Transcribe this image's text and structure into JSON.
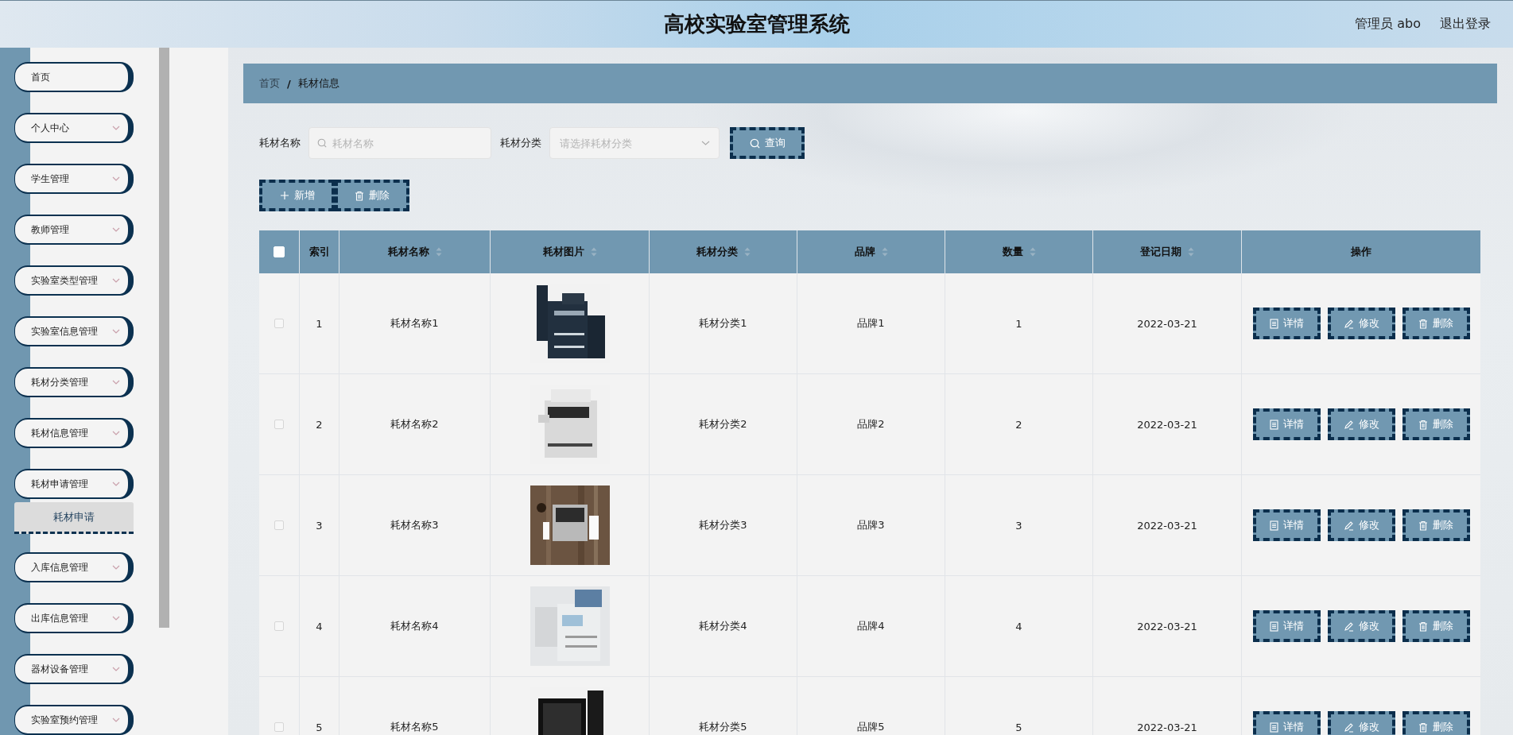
{
  "header": {
    "title": "高校实验室管理系统",
    "user": "管理员 abo",
    "logout": "退出登录"
  },
  "sidebar": {
    "items": [
      {
        "label": "首页",
        "kind": "link"
      },
      {
        "label": "个人中心",
        "kind": "submenu"
      },
      {
        "label": "学生管理",
        "kind": "submenu"
      },
      {
        "label": "教师管理",
        "kind": "submenu"
      },
      {
        "label": "实验室类型管理",
        "kind": "submenu"
      },
      {
        "label": "实验室信息管理",
        "kind": "submenu"
      },
      {
        "label": "耗材分类管理",
        "kind": "submenu"
      },
      {
        "label": "耗材信息管理",
        "kind": "submenu"
      },
      {
        "label": "耗材申请管理",
        "kind": "submenu",
        "children": [
          {
            "label": "耗材申请"
          }
        ]
      },
      {
        "label": "入库信息管理",
        "kind": "submenu"
      },
      {
        "label": "出库信息管理",
        "kind": "submenu"
      },
      {
        "label": "器材设备管理",
        "kind": "submenu"
      },
      {
        "label": "实验室预约管理",
        "kind": "submenu"
      }
    ]
  },
  "breadcrumb": {
    "items": [
      "首页",
      "耗材信息"
    ],
    "separator": "/"
  },
  "search": {
    "fields": [
      {
        "label": "耗材名称",
        "kind": "input",
        "placeholder": "耗材名称"
      },
      {
        "label": "耗材分类",
        "kind": "select",
        "placeholder": "请选择耗材分类"
      }
    ],
    "button": "查询"
  },
  "actions": [
    {
      "label": "新增"
    },
    {
      "label": "删除"
    }
  ],
  "table": {
    "select_all_checked": false,
    "columns": [
      {
        "label": "索引",
        "sortable": false
      },
      {
        "label": "耗材名称",
        "sortable": true
      },
      {
        "label": "耗材图片",
        "sortable": true
      },
      {
        "label": "耗材分类",
        "sortable": true
      },
      {
        "label": "品牌",
        "sortable": true
      },
      {
        "label": "数量",
        "sortable": true
      },
      {
        "label": "登记日期",
        "sortable": true
      },
      {
        "label": "操作",
        "sortable": false
      }
    ],
    "rows": [
      {
        "checked": false,
        "index": "1",
        "name": "耗材名称1",
        "category": "耗材分类1",
        "brand": "品牌1",
        "quantity": "1",
        "date": "2022-03-21",
        "actions": [
          "详情",
          "修改",
          "删除"
        ]
      },
      {
        "checked": false,
        "index": "2",
        "name": "耗材名称2",
        "category": "耗材分类2",
        "brand": "品牌2",
        "quantity": "2",
        "date": "2022-03-21",
        "actions": [
          "详情",
          "修改",
          "删除"
        ]
      },
      {
        "checked": false,
        "index": "3",
        "name": "耗材名称3",
        "category": "耗材分类3",
        "brand": "品牌3",
        "quantity": "3",
        "date": "2022-03-21",
        "actions": [
          "详情",
          "修改",
          "删除"
        ]
      },
      {
        "checked": false,
        "index": "4",
        "name": "耗材名称4",
        "category": "耗材分类4",
        "brand": "品牌4",
        "quantity": "4",
        "date": "2022-03-21",
        "actions": [
          "详情",
          "修改",
          "删除"
        ]
      },
      {
        "checked": false,
        "index": "5",
        "name": "耗材名称5",
        "category": "耗材分类5",
        "brand": "品牌5",
        "quantity": "5",
        "date": "2022-03-21",
        "actions": [
          "详情",
          "修改",
          "删除"
        ]
      }
    ]
  }
}
